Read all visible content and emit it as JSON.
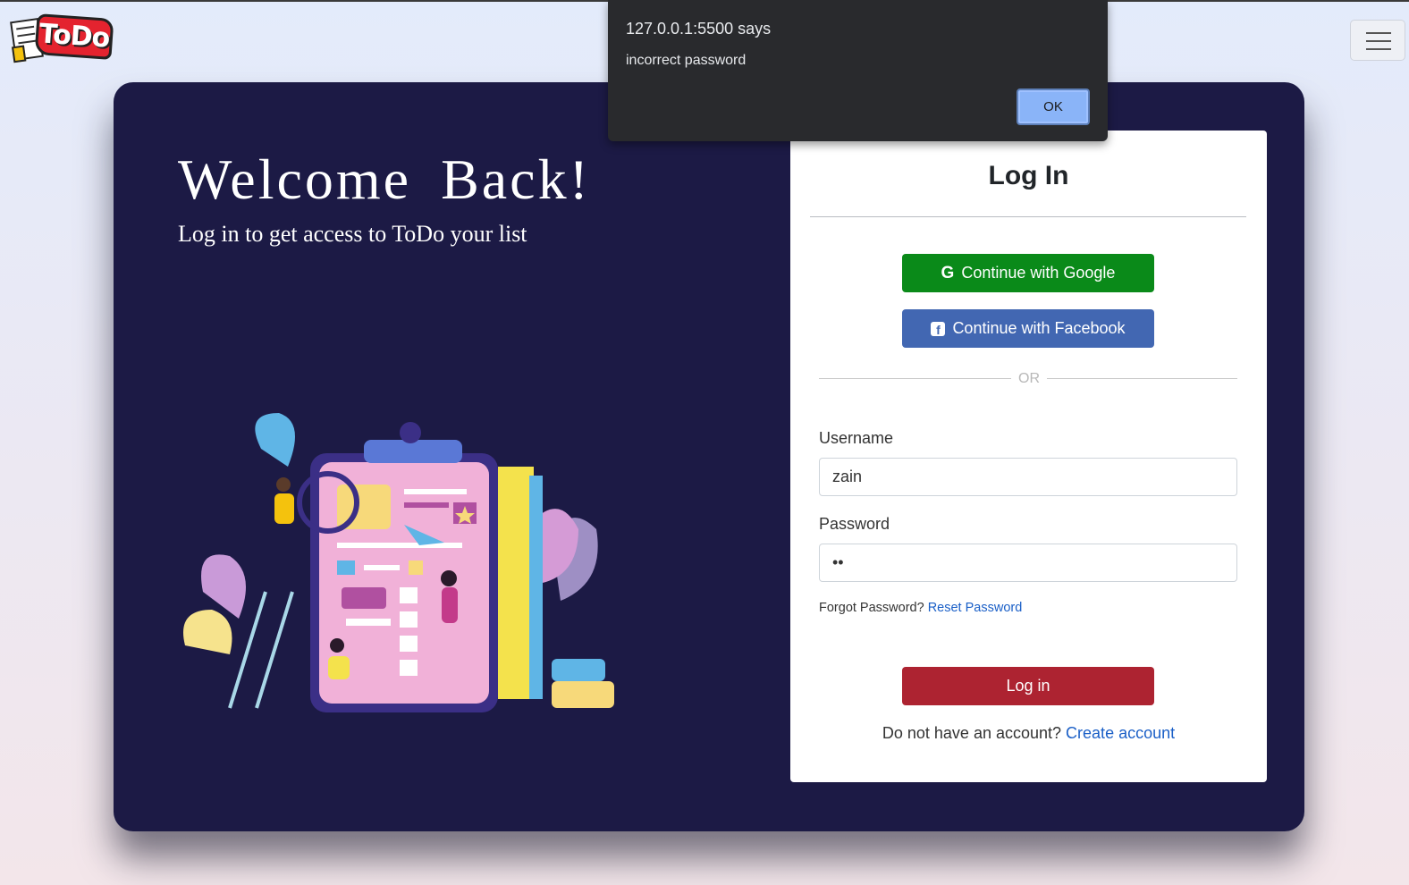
{
  "brand": {
    "logo_text": "ToDo"
  },
  "nav": {
    "menu_icon": "hamburger-icon"
  },
  "hero": {
    "title": "Welcome  Back!",
    "subtitle": "Log in to get access to ToDo your list"
  },
  "login": {
    "title": "Log In",
    "google_label": "Continue with Google",
    "facebook_label": "Continue with Facebook",
    "or_text": "OR",
    "username_label": "Username",
    "username_value": "zain",
    "password_label": "Password",
    "password_value": "••",
    "forgot_text": "Forgot Password?",
    "reset_link": "Reset Password",
    "login_button": "Log in",
    "no_account_text": "Do not have an account?",
    "create_link": "Create account"
  },
  "alert": {
    "title": "127.0.0.1:5500 says",
    "message": "incorrect password",
    "ok_label": "OK"
  },
  "colors": {
    "card_bg": "#1c1a45",
    "google": "#0a8a19",
    "facebook": "#4267b2",
    "login": "#ad2331",
    "link": "#1a5fc7"
  }
}
